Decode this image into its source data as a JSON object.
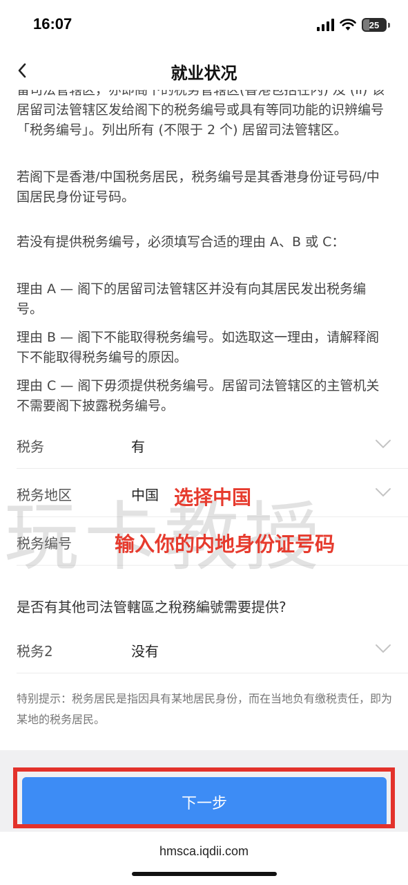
{
  "status_bar": {
    "time": "16:07",
    "battery": "25"
  },
  "nav": {
    "title": "就业状况"
  },
  "paragraphs": [
    "留司法管辖区，亦即阁下的税务管辖区(香港包括在内) 及 (ii) 该居留司法管辖区发给阁下的税务编号或具有等同功能的识辨编号「税务编号」。列出所有 (不限于 2 个) 居留司法管辖区。",
    "若阁下是香港/中国税务居民，税务编号是其香港身份证号码/中国居民身份证号码。",
    "若没有提供税务编号，必须填写合适的理由 A、B 或 C：",
    "理由 A — 阁下的居留司法管辖区并没有向其居民发出税务编号。",
    "理由 B — 阁下不能取得税务编号。如选取这一理由，请解释阁下不能取得税务编号的原因。",
    "理由 C — 阁下毋须提供税务编号。居留司法管辖区的主管机关不需要阁下披露税务编号。"
  ],
  "form": {
    "tax": {
      "label": "税务",
      "value": "有"
    },
    "tax_region": {
      "label": "税务地区",
      "value": "中国"
    },
    "tax_number": {
      "label": "税务编号",
      "value": ""
    },
    "question": "是否有其他司法管轄區之稅務編號需要提供?",
    "tax2": {
      "label": "税务2",
      "value": "没有"
    }
  },
  "tip": "特别提示：税务居民是指因具有某地居民身份，而在当地负有缴税责任，即为某地的税务居民。",
  "annotations": {
    "select_china": "选择中国",
    "enter_id": "输入你的内地身份证号码",
    "watermark": "玩卡教授"
  },
  "buttons": {
    "next": "下一步"
  },
  "browser": {
    "url": "hmsca.iqdii.com"
  },
  "colors": {
    "primary": "#3d8cf5",
    "annotation": "#e63b2e",
    "highlight": "#e3322b"
  }
}
